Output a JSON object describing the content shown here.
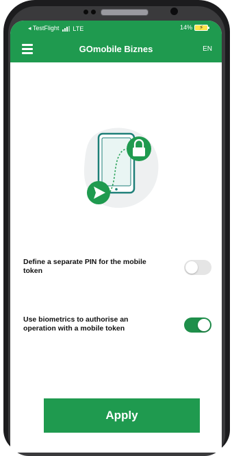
{
  "status_bar": {
    "carrier": "◂ TestFlight",
    "network": "LTE",
    "battery_percent": "14%",
    "battery_level": 0.14
  },
  "app_bar": {
    "title": "GOmobile Biznes",
    "language": "EN",
    "menu_icon": "hamburger-menu-icon"
  },
  "illustration": {
    "icons": [
      "phone-icon",
      "lock-icon",
      "send-arrow-icon"
    ]
  },
  "settings": [
    {
      "label": "Define a separate PIN for the mobile token",
      "enabled": false
    },
    {
      "label": "Use biometrics to authorise an operation with a mobile token",
      "enabled": true
    }
  ],
  "apply_label": "Apply",
  "colors": {
    "brand_green": "#1f9a4f",
    "toggle_on": "#1f8f4b",
    "toggle_off": "#e5e5e5"
  }
}
